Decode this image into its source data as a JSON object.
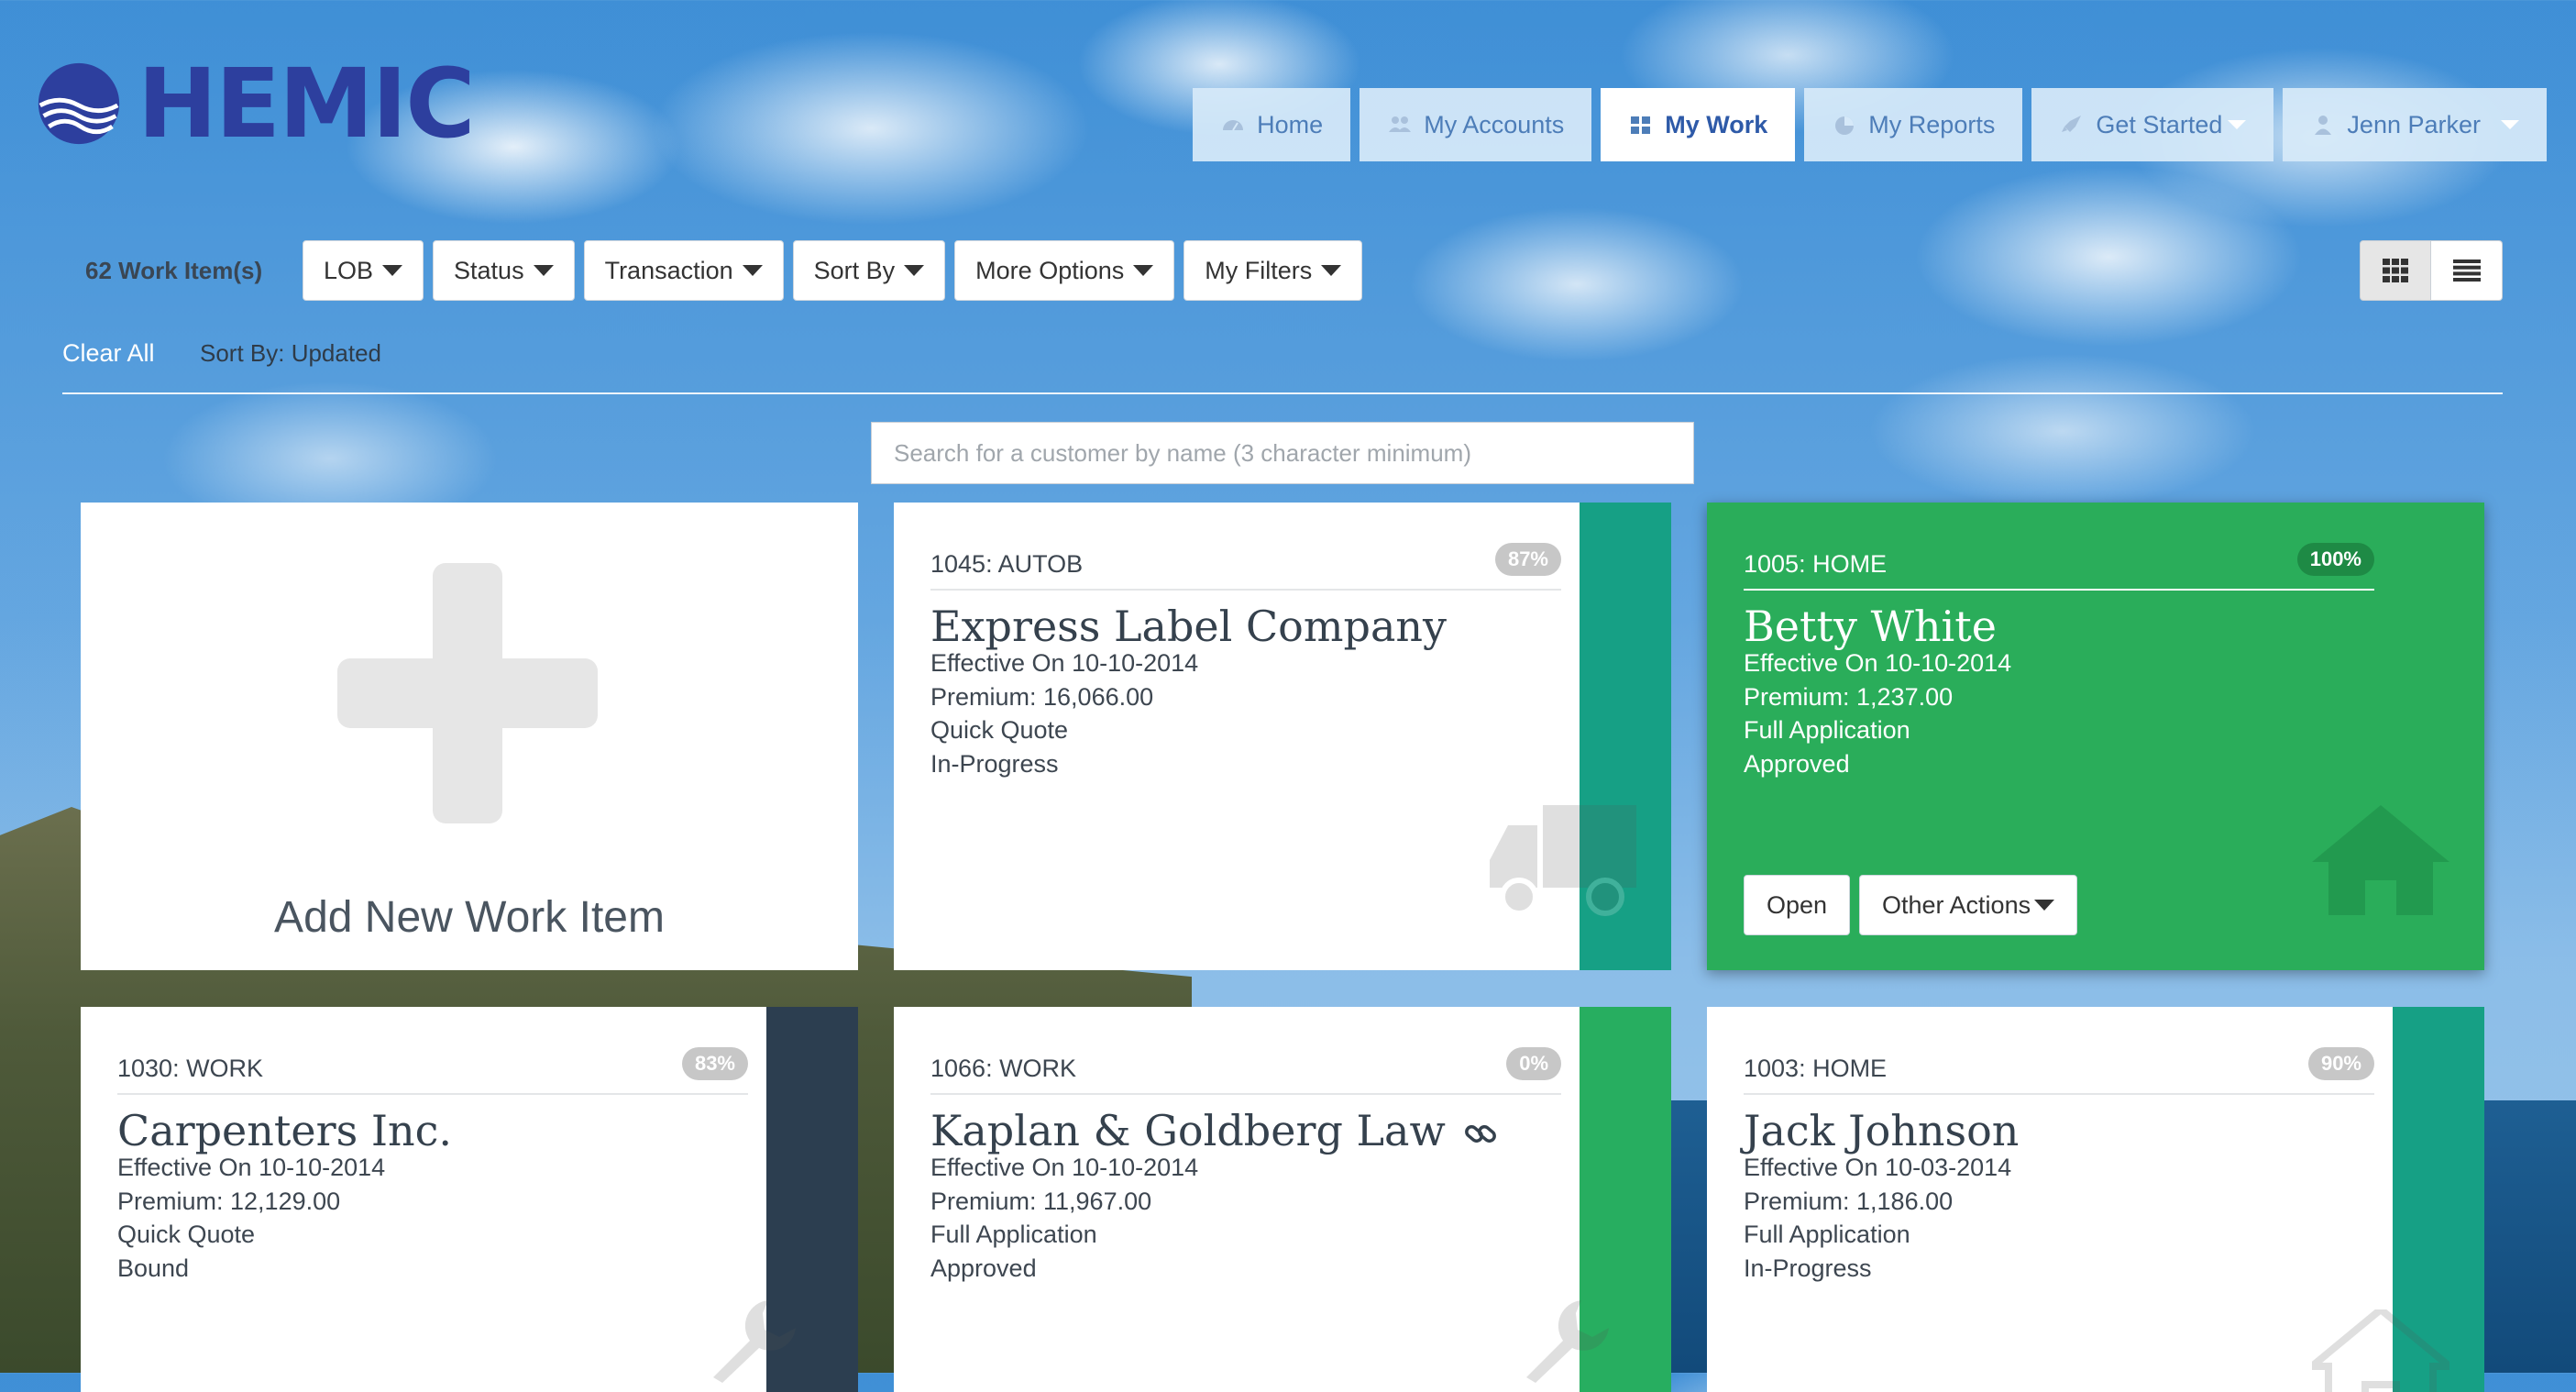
{
  "app": {
    "logo_text": "HEMIC"
  },
  "nav": {
    "items": [
      {
        "label": "Home",
        "icon": "dashboard-icon",
        "active": false
      },
      {
        "label": "My Accounts",
        "icon": "users-icon",
        "active": false
      },
      {
        "label": "My Work",
        "icon": "grid-icon",
        "active": true
      },
      {
        "label": "My Reports",
        "icon": "pie-chart-icon",
        "active": false
      },
      {
        "label": "Get Started",
        "icon": "rocket-icon",
        "active": false,
        "dropdown": true
      },
      {
        "label": "Jenn Parker",
        "icon": "user-icon",
        "active": false,
        "dropdown": true
      }
    ]
  },
  "toolbar": {
    "count": "62 Work Item(s)",
    "filters": [
      "LOB",
      "Status",
      "Transaction",
      "Sort By",
      "More Options",
      "My Filters"
    ],
    "clear_all": "Clear All",
    "sort_by": "Sort By: Updated"
  },
  "search": {
    "placeholder": "Search for a customer by name (3 character minimum)",
    "value": ""
  },
  "add_card": {
    "label": "Add New Work Item"
  },
  "cards": [
    {
      "code": "1045: AUTOB",
      "badge": "87%",
      "name": "Express Label Company",
      "effective": "Effective On 10-10-2014",
      "premium": "Premium: 16,066.00",
      "transaction": "Quick Quote",
      "status": "In-Progress",
      "stripe_color": "#16a085",
      "icon": "truck-icon"
    },
    {
      "code": "1005: HOME",
      "badge": "100%",
      "name": "Betty White",
      "effective": "Effective On 10-10-2014",
      "premium": "Premium: 1,237.00",
      "transaction": "Full Application",
      "status": "Approved",
      "icon": "home-icon",
      "open_label": "Open",
      "other_label": "Other Actions",
      "card_color": "#2aad5a"
    },
    {
      "code": "1030: WORK",
      "badge": "83%",
      "name": "Carpenters Inc.",
      "effective": "Effective On 10-10-2014",
      "premium": "Premium: 12,129.00",
      "transaction": "Quick Quote",
      "status": "Bound",
      "stripe_color": "#2c3e50",
      "icon": "wrench-icon"
    },
    {
      "code": "1066: WORK",
      "badge": "0%",
      "name": "Kaplan & Goldberg Law",
      "effective": "Effective On 10-10-2014",
      "premium": "Premium: 11,967.00",
      "transaction": "Full Application",
      "status": "Approved",
      "stripe_color": "#27ae60",
      "icon": "wrench-icon",
      "linked_icon": "link-icon"
    },
    {
      "code": "1003: HOME",
      "badge": "90%",
      "name": "Jack Johnson",
      "effective": "Effective On 10-03-2014",
      "premium": "Premium: 1,186.00",
      "transaction": "Full Application",
      "status": "In-Progress",
      "stripe_color": "#16a085",
      "icon": "home-icon"
    }
  ]
}
